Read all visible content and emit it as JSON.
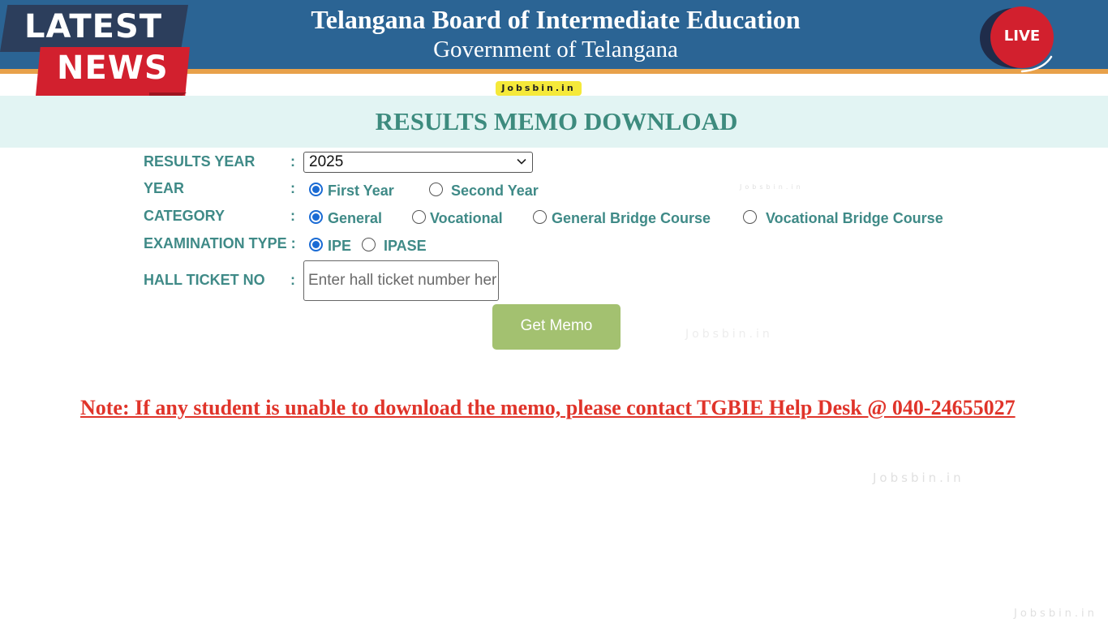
{
  "header": {
    "title": "Telangana Board of Intermediate Education",
    "subtitle": "Government of Telangana"
  },
  "badge": {
    "latest": "LATEST",
    "news": "NEWS",
    "live": "LIVE"
  },
  "watermark": {
    "main": "Jobsbin.in",
    "faint": "Jobsbin.in"
  },
  "banner": {
    "title": "RESULTS MEMO DOWNLOAD"
  },
  "form": {
    "colon": ":",
    "results_year": {
      "label": "RESULTS YEAR",
      "selected": "2025"
    },
    "year": {
      "label": "YEAR",
      "options": [
        "First Year",
        "Second Year"
      ],
      "selected": "First Year"
    },
    "category": {
      "label": "CATEGORY",
      "options": [
        "General",
        "Vocational",
        "General Bridge Course",
        "Vocational Bridge Course"
      ],
      "selected": "General"
    },
    "exam_type": {
      "label": "EXAMINATION TYPE :",
      "options": [
        "IPE",
        "IPASE"
      ],
      "selected": "IPE"
    },
    "hall_ticket": {
      "label": "HALL TICKET NO",
      "value": "",
      "placeholder": "Enter hall ticket number her"
    },
    "submit_label": "Get Memo"
  },
  "note": "Note: If any student is unable to download the memo, please contact TGBIE Help Desk @ 040-24655027",
  "colors": {
    "header_bg": "#2b6494",
    "accent_stripe": "#e8a14a",
    "label_teal": "#3f8a87",
    "title_teal": "#3d8b7e",
    "banner_bg": "#e2f4f3",
    "button_green": "#a3c170",
    "note_red": "#e0342a",
    "radio_blue": "#1a6bd4"
  }
}
